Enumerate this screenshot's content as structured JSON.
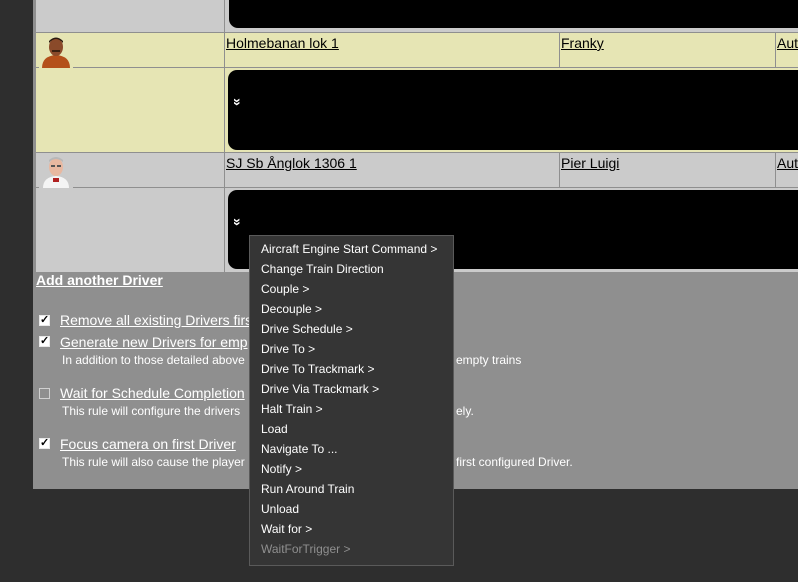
{
  "drivers": [
    {
      "avatar": "avatar-man-orange",
      "train": "Holmebanan lok 1",
      "driver": "Franky",
      "extra": "Aut",
      "expand_icon": "»"
    },
    {
      "avatar": "avatar-man-white",
      "train": "SJ Sb Ånglok 1306 1",
      "driver": "Pier Luigi",
      "extra": "Aut",
      "expand_icon": "»"
    }
  ],
  "add_driver_label": "Add another Driver",
  "options": {
    "remove_existing": {
      "label": "Remove all existing Drivers first",
      "checked": true
    },
    "generate_new": {
      "label": "Generate new Drivers for emp",
      "checked": true,
      "desc_left": "In addition to those detailed above",
      "desc_right": "empty trains"
    },
    "wait_schedule": {
      "label": "Wait for Schedule Completion",
      "checked": false,
      "desc_left": "This rule will configure the drivers",
      "desc_right": "ely."
    },
    "focus_camera": {
      "label": "Focus camera on first Driver",
      "checked": true,
      "desc_left": "This rule will also cause the player",
      "desc_right": "first configured Driver."
    }
  },
  "context_menu": {
    "items": [
      {
        "label": "Aircraft Engine Start Command >",
        "enabled": true
      },
      {
        "label": "Change Train Direction",
        "enabled": true
      },
      {
        "label": "Couple >",
        "enabled": true
      },
      {
        "label": "Decouple >",
        "enabled": true
      },
      {
        "label": "Drive Schedule >",
        "enabled": true
      },
      {
        "label": "Drive To >",
        "enabled": true
      },
      {
        "label": "Drive To Trackmark >",
        "enabled": true
      },
      {
        "label": "Drive Via Trackmark >",
        "enabled": true
      },
      {
        "label": "Halt Train >",
        "enabled": true
      },
      {
        "label": "Load",
        "enabled": true
      },
      {
        "label": "Navigate To ...",
        "enabled": true
      },
      {
        "label": "Notify >",
        "enabled": true
      },
      {
        "label": "Run Around Train",
        "enabled": true
      },
      {
        "label": "Unload",
        "enabled": true
      },
      {
        "label": "Wait for >",
        "enabled": true
      },
      {
        "label": "WaitForTrigger >",
        "enabled": false
      }
    ]
  },
  "colors": {
    "row_highlight": "#e6e5b4",
    "row_normal": "#cbcbcb",
    "panel": "#8f8f8f",
    "menu_bg": "#353535"
  }
}
